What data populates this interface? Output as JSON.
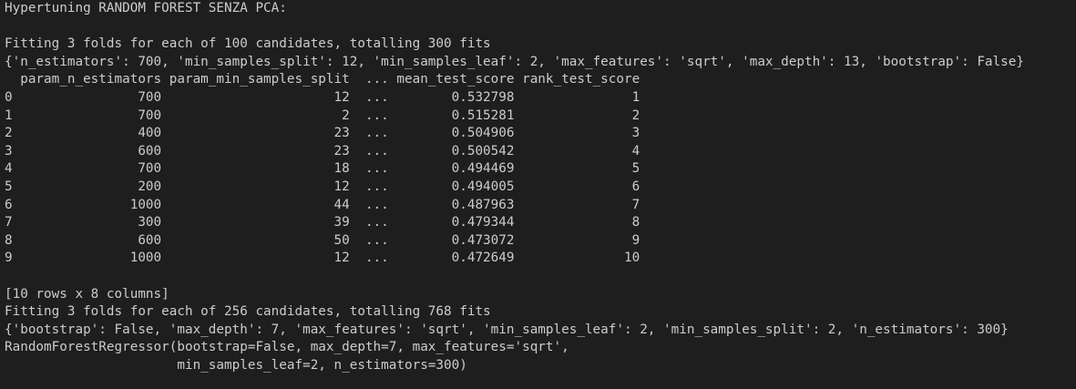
{
  "terminal": {
    "lines": [
      "Hypertuning RANDOM FOREST SENZA PCA:",
      "",
      "Fitting 3 folds for each of 100 candidates, totalling 300 fits",
      "{'n_estimators': 700, 'min_samples_split': 12, 'min_samples_leaf': 2, 'max_features': 'sqrt', 'max_depth': 13, 'bootstrap': False}",
      "  param_n_estimators param_min_samples_split  ... mean_test_score rank_test_score",
      "0                700                      12  ...        0.532798               1",
      "1                700                       2  ...        0.515281               2",
      "2                400                      23  ...        0.504906               3",
      "3                600                      23  ...        0.500542               4",
      "4                700                      18  ...        0.494469               5",
      "5                200                      12  ...        0.494005               6",
      "6               1000                      44  ...        0.487963               7",
      "7                300                      39  ...        0.479344               8",
      "8                600                      50  ...        0.473072               9",
      "9               1000                      12  ...        0.472649              10",
      "",
      "[10 rows x 8 columns]",
      "Fitting 3 folds for each of 256 candidates, totalling 768 fits",
      "{'bootstrap': False, 'max_depth': 7, 'max_features': 'sqrt', 'min_samples_leaf': 2, 'min_samples_split': 2, 'n_estimators': 300}",
      "RandomForestRegressor(bootstrap=False, max_depth=7, max_features='sqrt',",
      "                      min_samples_leaf=2, n_estimators=300)"
    ]
  }
}
